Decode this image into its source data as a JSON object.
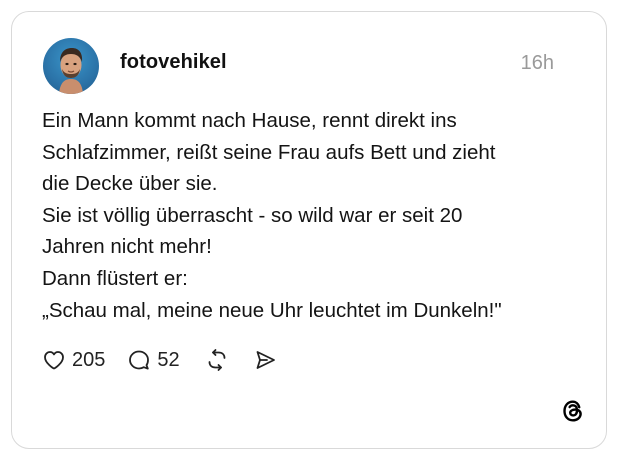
{
  "post": {
    "username": "fotovehikel",
    "timestamp": "16h",
    "text_lines": [
      "Ein Mann kommt nach Hause, rennt direkt ins",
      "Schlafzimmer, reißt seine Frau aufs Bett und zieht",
      "die Decke über sie.",
      "Sie ist völlig überrascht - so wild war er seit 20",
      "Jahren nicht mehr!",
      "Dann flüstert er:",
      "„Schau mal, meine neue Uhr leuchtet im Dunkeln!\""
    ],
    "likes": "205",
    "replies": "52"
  },
  "icons": {
    "like": "heart-icon",
    "reply": "speech-bubble-icon",
    "repost": "repost-arrows-icon",
    "share": "send-icon",
    "brand": "threads-logo"
  },
  "colors": {
    "text": "#141414",
    "muted": "#9a9a9a",
    "border": "#d9d9d9"
  }
}
